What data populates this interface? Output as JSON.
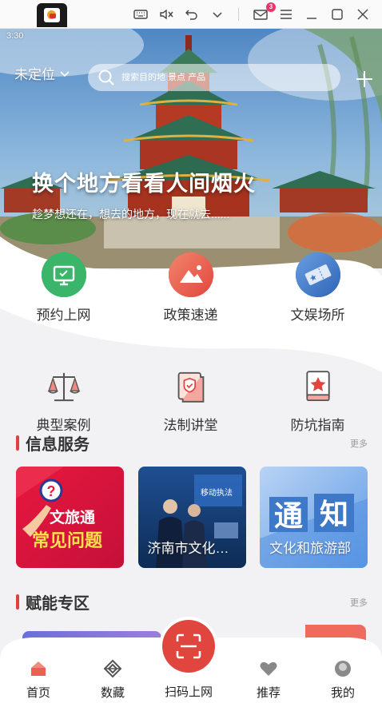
{
  "status_bar": {
    "time": "3:30"
  },
  "emulator": {
    "mail_badge": "3"
  },
  "header": {
    "location": "未定位",
    "search_placeholder": "搜索目的地 景点 产品"
  },
  "hero": {
    "title": "换个地方看看人间烟火",
    "subtitle": "趁梦想还在，想去的地方，现在就去......"
  },
  "quick_row1": [
    {
      "label": "预约上网",
      "icon": "computer-icon",
      "color": "#3ab56a"
    },
    {
      "label": "政策速递",
      "icon": "mountain-icon",
      "color": "#ea5b52"
    },
    {
      "label": "文娱场所",
      "icon": "ticket-icon",
      "color": "#3e79c9"
    }
  ],
  "quick_row2": [
    {
      "label": "典型案例",
      "icon": "scales-icon"
    },
    {
      "label": "法制讲堂",
      "icon": "shield-book-icon"
    },
    {
      "label": "防坑指南",
      "icon": "star-book-icon"
    }
  ],
  "info_section": {
    "title": "信息服务",
    "more": "更多",
    "cards": [
      {
        "text": "",
        "poster_line1": "文旅通",
        "poster_line2": "常见问题"
      },
      {
        "text": "济南市文化和旅游局",
        "poster_line1": "移动执法"
      },
      {
        "text": "文化和旅游部",
        "poster_line1": "通",
        "poster_line2": "知"
      }
    ]
  },
  "enable_section": {
    "title": "赋能专区",
    "more": "更多"
  },
  "bottom_nav": {
    "home": "首页",
    "collect": "数藏",
    "scan": "扫码上网",
    "recommend": "推荐",
    "mine": "我的"
  },
  "colors": {
    "accent": "#e0463d",
    "section_bar": "#e04040"
  }
}
